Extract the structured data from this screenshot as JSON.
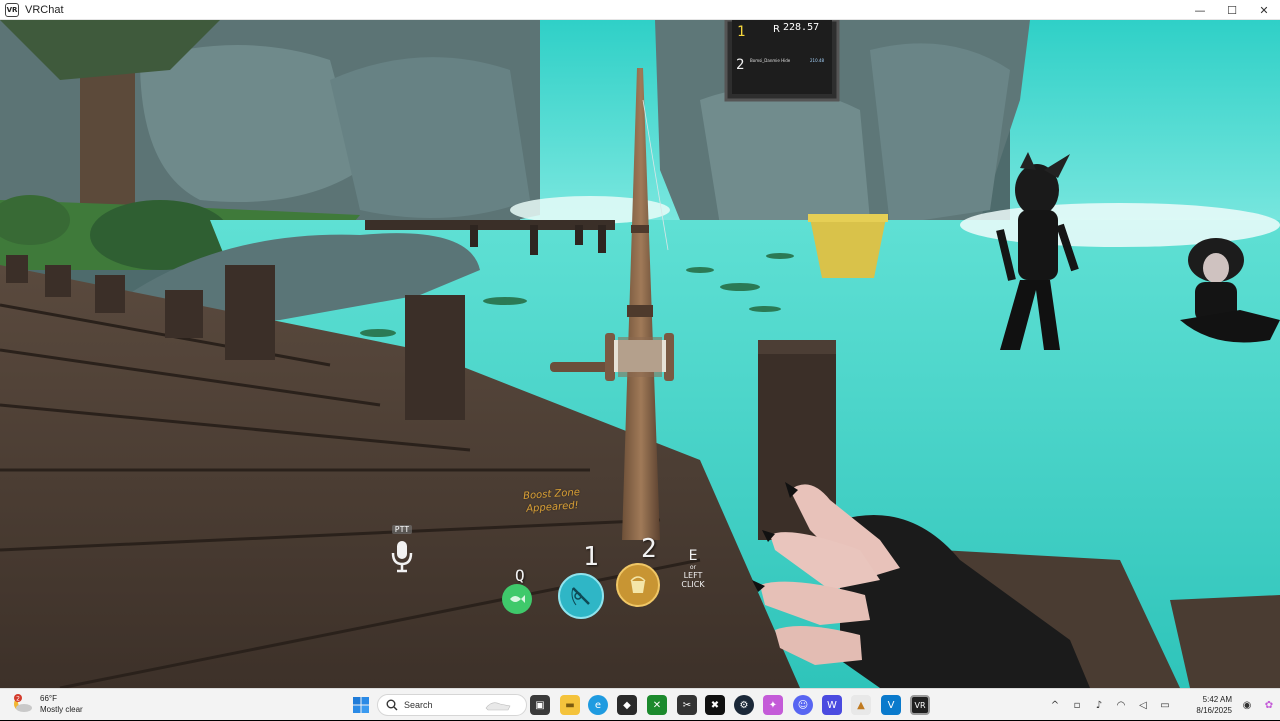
{
  "window": {
    "app_icon_text": "VR",
    "title": "VRChat",
    "minimize": "—",
    "maximize": "☐",
    "close": "✕"
  },
  "game": {
    "scoreboard": [
      {
        "rank": "1",
        "value": "228.57"
      },
      {
        "rank": "2",
        "name": "Bomsi_Danmie Hide",
        "value": "210.48"
      }
    ],
    "hud": {
      "boost_message": "Boost Zone\nAppeared!",
      "ptt_label": "PTT",
      "slots": [
        {
          "key": "Q",
          "item": "fish",
          "color": "#3fc96b"
        },
        {
          "key": "1",
          "item": "fishing-rod",
          "color": "#2fb6c6"
        },
        {
          "key": "2",
          "item": "bucket",
          "color": "#c89533"
        }
      ],
      "action_key": "E",
      "action_or": "or",
      "action_label": "LEFT\nCLICK"
    },
    "colors": {
      "water": "#3ecfc3",
      "dock": "#4a3d33",
      "rock": "#5d7779"
    }
  },
  "taskbar": {
    "weather": {
      "temp": "66°F",
      "desc": "Mostly clear",
      "badge": "2"
    },
    "search_placeholder": "Search",
    "tray": {
      "time": "5:42 AM",
      "date": "8/16/2025",
      "caret": "^"
    },
    "apps": [
      "windows-start",
      "search",
      "task-view",
      "file-explorer",
      "edge",
      "xbox",
      "snip",
      "capcut",
      "steam",
      "copilot",
      "discord",
      "wacom",
      "shopping",
      "vscode",
      "vrchat"
    ]
  }
}
